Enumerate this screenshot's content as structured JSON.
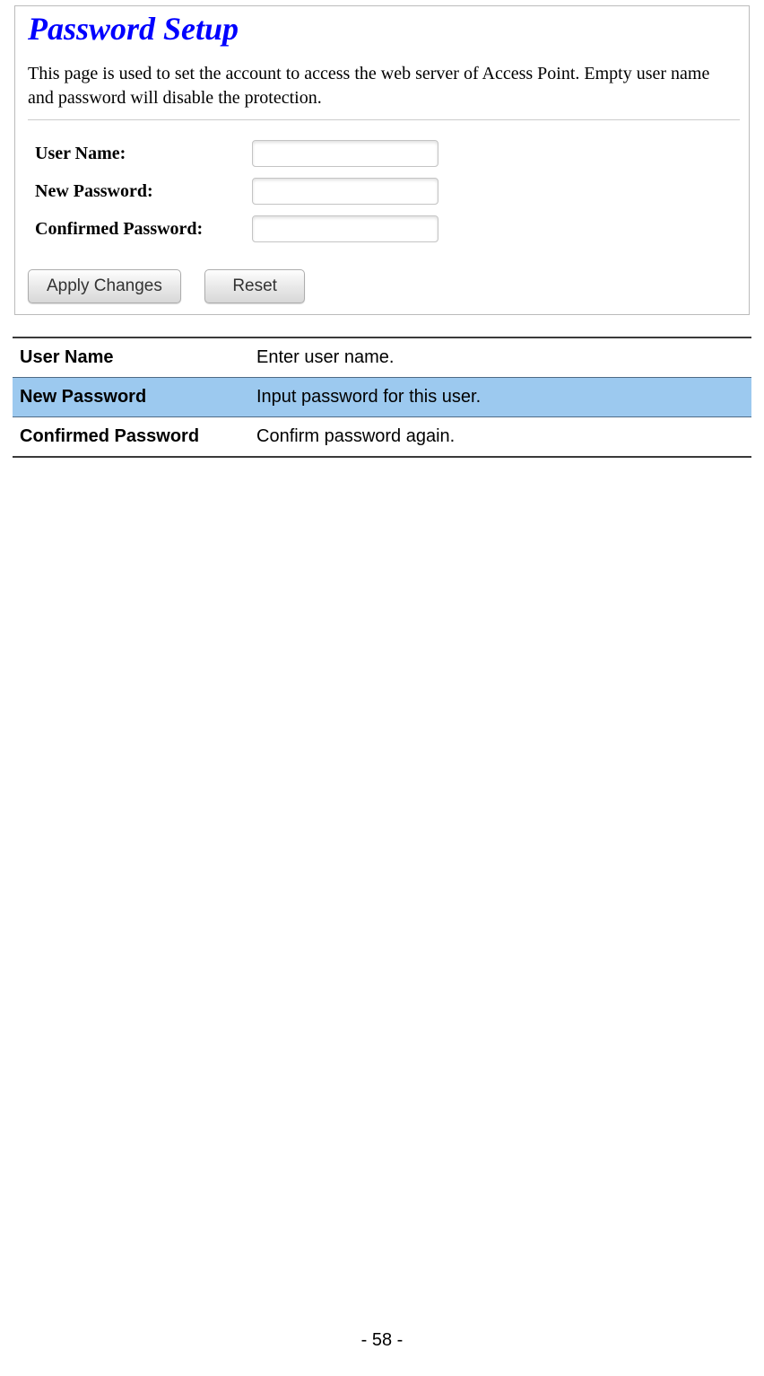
{
  "panel": {
    "title": "Password Setup",
    "description": "This page is used to set the account to access the web server of Access Point. Empty user name and password will disable the protection.",
    "fields": {
      "user_name_label": "User Name:",
      "new_password_label": "New Password:",
      "confirmed_password_label": "Confirmed Password:"
    },
    "buttons": {
      "apply": "Apply Changes",
      "reset": "Reset"
    }
  },
  "description_table": [
    {
      "field": "User Name",
      "desc": "Enter user name."
    },
    {
      "field": "New Password",
      "desc": "Input password for this user."
    },
    {
      "field": "Confirmed Password",
      "desc": "Confirm password again."
    }
  ],
  "page_number": "- 58 -"
}
